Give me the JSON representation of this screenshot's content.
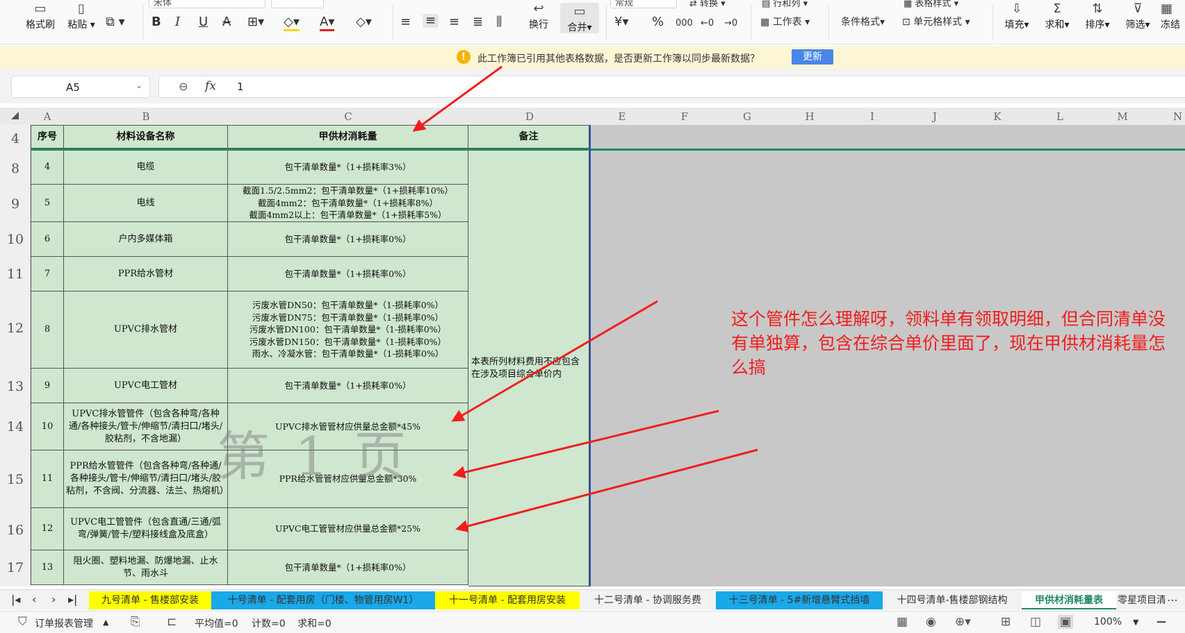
{
  "ribbon": {
    "format_painter": "格式刷",
    "paste": "粘贴",
    "font_name": "宋体",
    "wrap_text": "换行",
    "merge": "合并",
    "number_format": "常规",
    "convert": "转换",
    "rows_cols": "行和列",
    "worksheet": "工作表",
    "table_style": "表格样式",
    "conditional_format": "条件格式",
    "cell_style": "单元格样式",
    "fill": "填充",
    "sum": "求和",
    "sort": "排序",
    "filter": "筛选",
    "freeze": "冻结",
    "currency_symbol": "¥",
    "percent_symbol": "%",
    "thousands_symbol": "000"
  },
  "notice": {
    "message": "此工作簿已引用其他表格数据，是否更新工作簿以同步最新数据？",
    "update_button": "更新"
  },
  "formula_bar": {
    "cell_ref": "A5",
    "fx": "fx",
    "value": "1"
  },
  "columns": [
    "A",
    "B",
    "C",
    "D",
    "E",
    "F",
    "G",
    "H",
    "I",
    "J",
    "K",
    "L",
    "M",
    "N"
  ],
  "table": {
    "header_row_number": "4",
    "headers": [
      "序号",
      "材料设备名称",
      "甲供材消耗量",
      "备注"
    ],
    "rows": [
      {
        "row": "8",
        "no": "4",
        "name": "电缆",
        "qty": [
          "包干清单数量*（1+损耗率3%）"
        ]
      },
      {
        "row": "9",
        "no": "5",
        "name": "电线",
        "qty": [
          "截面1.5/2.5mm2：包干清单数量*（1+损耗率10%）",
          "截面4mm2：包干清单数量*（1+损耗率8%）",
          "截面4mm2以上：包干清单数量*（1+损耗率5%）"
        ]
      },
      {
        "row": "10",
        "no": "6",
        "name": "户内多媒体箱",
        "qty": [
          "包干清单数量*（1+损耗率0%）"
        ]
      },
      {
        "row": "11",
        "no": "7",
        "name": "PPR给水管材",
        "qty": [
          "包干清单数量*（1+损耗率0%）"
        ]
      },
      {
        "row": "12",
        "no": "8",
        "name": "UPVC排水管材",
        "qty": [
          "污废水管DN50：包干清单数量*（1-损耗率0%）",
          "污废水管DN75：包干清单数量*（1-损耗率0%）",
          "污废水管DN100：包干清单数量*（1-损耗率0%）",
          "污废水管DN150：包干清单数量*（1-损耗率0%）",
          "雨水、冷凝水管：包干清单数量*（1-损耗率0%）"
        ]
      },
      {
        "row": "13",
        "no": "9",
        "name": "UPVC电工管材",
        "qty": [
          "包干清单数量*（1+损耗率0%）"
        ]
      },
      {
        "row": "14",
        "no": "10",
        "name": "UPVC排水管管件（包含各种弯/各种通/各种接头/管卡/伸缩节/清扫口/堵头/胶粘剂，不含地漏）",
        "qty": [
          "UPVC排水管管材应供量总金额*45%"
        ]
      },
      {
        "row": "15",
        "no": "11",
        "name": "PPR给水管管件（包含各种弯/各种通/各种接头/管卡/伸缩节/清扫口/堵头/胶粘剂，不含阀、分流器、法兰、热熔机）",
        "qty": [
          "PPR给水管管材应供量总金额*30%"
        ]
      },
      {
        "row": "16",
        "no": "12",
        "name": "UPVC电工管管件（包含直通/三通/弧弯/弹簧/管卡/塑料接线盒及底盒）",
        "qty": [
          "UPVC电工管管材应供量总金额*25%"
        ]
      },
      {
        "row": "17",
        "no": "13",
        "name": "阻火圈、塑料地漏、防爆地漏、止水节、雨水斗",
        "qty": [
          "包干清单数量*（1+损耗率0%）"
        ]
      }
    ],
    "remark": "本表所列材料费用不应包含在涉及项目综合单价内"
  },
  "watermark": "第 1 页",
  "annotation": "这个管件怎么理解呀，领料单有领取明细，但合同清单没有单独算，包含在综合单价里面了，现在甲供材消耗量怎么搞",
  "colors": {
    "cell_fill": "#cfe6cf",
    "annotation": "#f21d1d",
    "active_tab": "#1e8a5e",
    "tab_yellow": "#ffff00",
    "tab_blue": "#19a8e8"
  },
  "sheet_tabs": [
    {
      "label": "九号清单 - 售楼部安装",
      "style": "yellow"
    },
    {
      "label": "十号清单 - 配套用房（门楼、物管用房W1）",
      "style": "blue"
    },
    {
      "label": "十一号清单 - 配套用房安装",
      "style": "yellow"
    },
    {
      "label": "十二号清单 - 协调服务费",
      "style": "plain"
    },
    {
      "label": "十三号清单 - 5#新增悬臂式挡墙",
      "style": "blue"
    },
    {
      "label": "十四号清单-售楼部钢结构",
      "style": "plain"
    },
    {
      "label": "甲供材消耗量表",
      "style": "active"
    },
    {
      "label": "零星项目清",
      "style": "plain"
    }
  ],
  "status_bar": {
    "macro_label": "订单报表管理",
    "average": "平均值=0",
    "count": "计数=0",
    "sum": "求和=0",
    "zoom": "100%"
  }
}
